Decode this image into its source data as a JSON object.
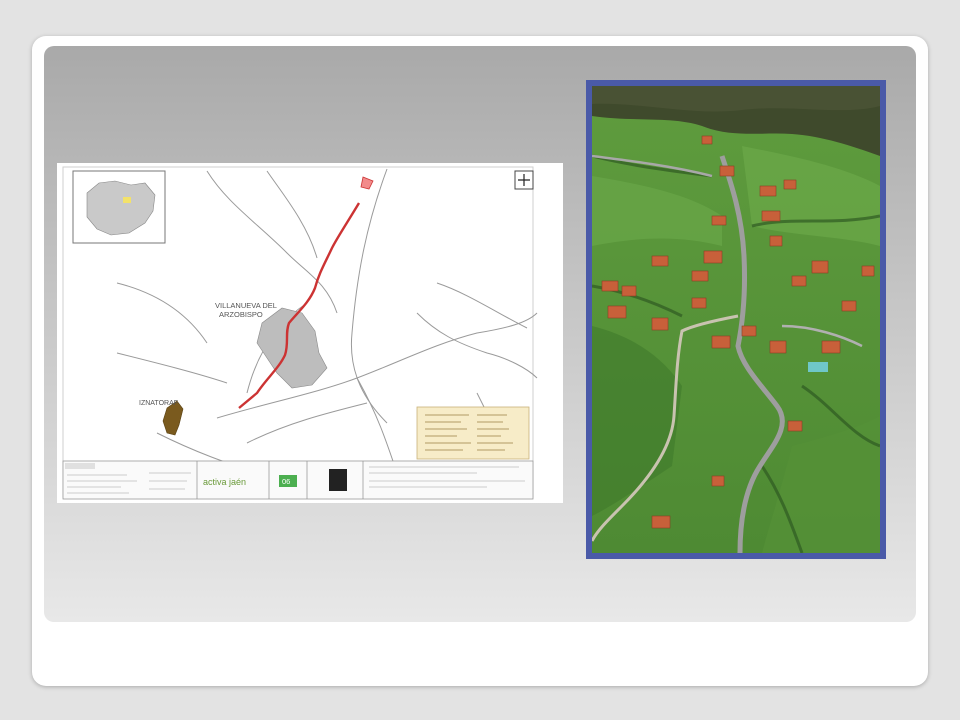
{
  "slide": {
    "map": {
      "place_labels": [
        "VILLANUEVA DEL",
        "ARZOBISPO",
        "IZNATORAF"
      ],
      "logo_text": "activa jaén",
      "badge_text": "06",
      "colors": {
        "route": "#cc3333",
        "urban": "#bdbdbd",
        "roads": "#9a9a9a",
        "legend_fill": "#f7ecc8",
        "badge": "#4caf50"
      }
    },
    "photo": {
      "colors": {
        "frame": "#4a5aa8",
        "grass": "#5c9a3c",
        "forest": "#3f4a2c",
        "road": "#9e9e9e",
        "roof": "#c8603a"
      }
    }
  }
}
